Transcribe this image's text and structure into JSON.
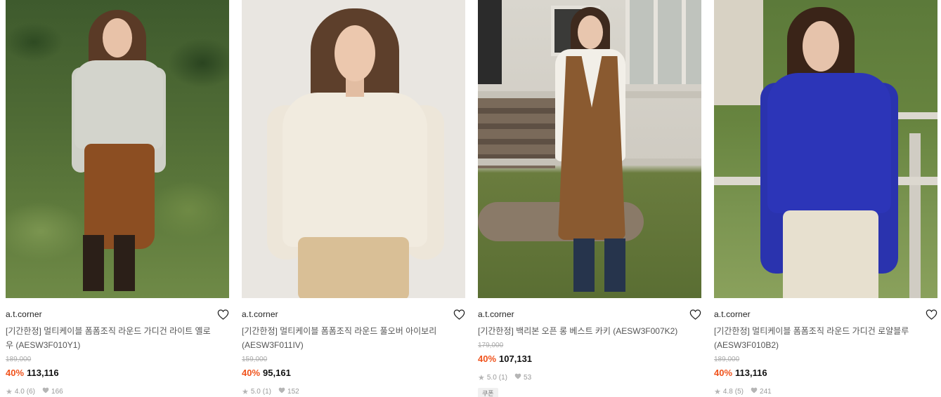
{
  "products": [
    {
      "brand": "a.t.corner",
      "title": "[기간한정] 멀티케이블 폼폼조직 라운드 가디건 라이트 옐로우 (AESW3F010Y1)",
      "original_price": "189,000",
      "discount": "40%",
      "price": "113,116",
      "rating": "4.0",
      "reviews": "(6)",
      "likes": "166",
      "tag": ""
    },
    {
      "brand": "a.t.corner",
      "title": "[기간한정] 멀티케이블 폼폼조직 라운드 풀오버 아이보리 (AESW3F011IV)",
      "original_price": "159,000",
      "discount": "40%",
      "price": "95,161",
      "rating": "5.0",
      "reviews": "(1)",
      "likes": "152",
      "tag": ""
    },
    {
      "brand": "a.t.corner",
      "title": "[기간한정] 백리본 오픈 롱 베스트 카키 (AESW3F007K2)",
      "original_price": "179,000",
      "discount": "40%",
      "price": "107,131",
      "rating": "5.0",
      "reviews": "(1)",
      "likes": "53",
      "tag": "쿠폰"
    },
    {
      "brand": "a.t.corner",
      "title": "[기간한정] 멀티케이블 폼폼조직 라운드 가디건 로얄블루 (AESW3F010B2)",
      "original_price": "189,000",
      "discount": "40%",
      "price": "113,116",
      "rating": "4.8",
      "reviews": "(5)",
      "likes": "241",
      "tag": ""
    }
  ],
  "icons": {
    "wishlist": "heart-outline-icon",
    "rating": "star-icon",
    "likes": "heart-filled-icon"
  },
  "colors": {
    "discount": "#f0531c",
    "original_price": "#aaaaaa",
    "meta": "#999999"
  }
}
